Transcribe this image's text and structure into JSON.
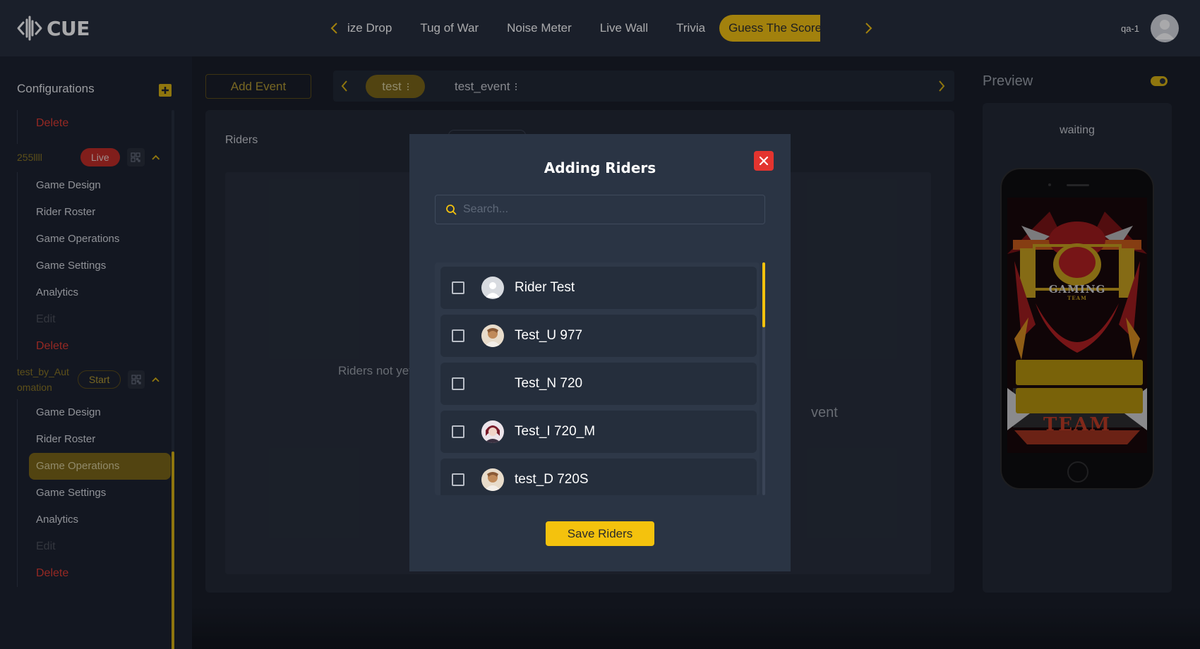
{
  "app": {
    "logo_text": "CUE"
  },
  "nav": {
    "tabs": [
      "ize Drop",
      "Tug of War",
      "Noise Meter",
      "Live Wall",
      "Trivia"
    ],
    "active_tab": "Guess The Score"
  },
  "user": {
    "name": "qa-1"
  },
  "sidebar": {
    "title": "Configurations",
    "top_delete": "Delete",
    "groups": [
      {
        "name": "255llll",
        "status": "Live",
        "items": [
          "Game Design",
          "Rider Roster",
          "Game Operations",
          "Game Settings",
          "Analytics"
        ],
        "edit": "Edit",
        "delete": "Delete"
      },
      {
        "name": "test_by_Aut omation",
        "status": "Start",
        "items": [
          "Game Design",
          "Rider Roster",
          "Game Operations",
          "Game Settings",
          "Analytics"
        ],
        "active_item": "Game Operations",
        "edit": "Edit",
        "delete": "Delete"
      }
    ]
  },
  "main": {
    "add_event": "Add Event",
    "event_tabs": [
      "test",
      "test_event"
    ],
    "active_event": "test",
    "panel_title": "Riders",
    "empty_text": "Riders not yet ad",
    "empty_text_right": "vent"
  },
  "preview": {
    "title": "Preview",
    "status": "waiting",
    "toggle_on": true,
    "image_text_top": "GAMING",
    "image_text_small": "TEAM",
    "image_text_bottom": "TEAM"
  },
  "modal": {
    "title": "Adding Riders",
    "search_placeholder": "Search...",
    "riders": [
      {
        "name": "Rider Test",
        "avatar": "default",
        "checked": false
      },
      {
        "name": "Test_U 977",
        "avatar": "photo",
        "checked": false
      },
      {
        "name": "Test_N 720",
        "avatar": "none",
        "checked": false
      },
      {
        "name": "Test_I 720_M",
        "avatar": "photo-red",
        "checked": false
      },
      {
        "name": "test_D 720S",
        "avatar": "photo",
        "checked": false
      }
    ],
    "save_label": "Save Riders"
  },
  "colors": {
    "accent": "#f4c20d",
    "danger": "#e3342f",
    "topbar": "#242c3a",
    "modal": "#2a3444"
  }
}
